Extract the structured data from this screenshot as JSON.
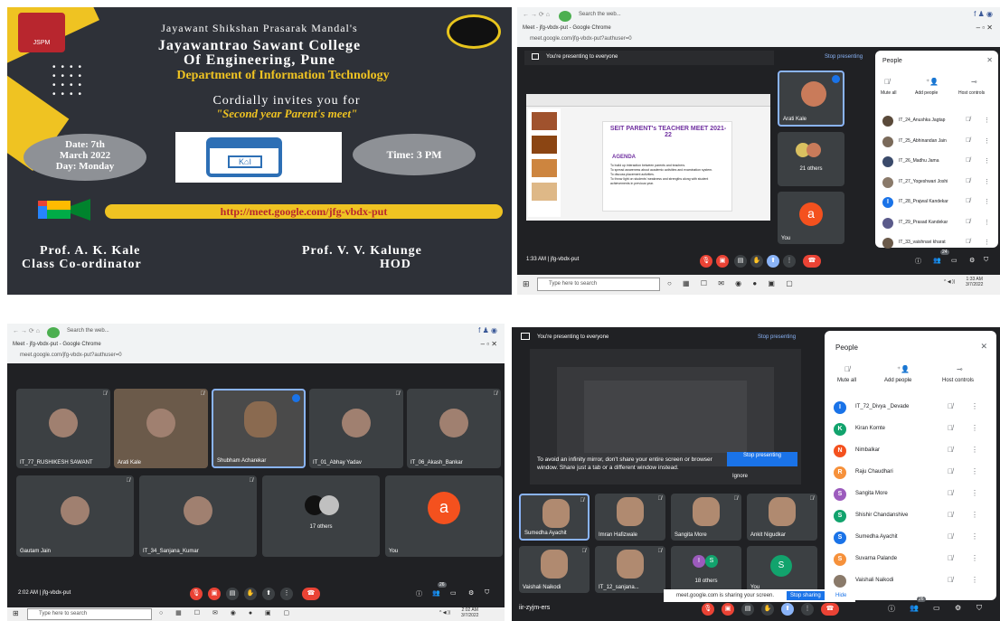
{
  "poster": {
    "org": "Jayawant Shikshan Prasarak Mandal's",
    "college_line1": "Jayawantrao Sawant College",
    "college_line2": "Of Engineering, Pune",
    "department": "Department of Information Technology",
    "invite": "Cordially invites you for",
    "event": "\"Second year Parent's meet\"",
    "date_line1": "Date: 7th",
    "date_line2": "March 2022",
    "date_line3": "Day: Monday",
    "time": "Time: 3 PM",
    "link": "http://meet.google.com/jfg-vbdx-put",
    "left_name": "Prof. A. K. Kale",
    "left_role": "Class Co-ordinator",
    "right_name": "Prof. V. V. Kalunge",
    "right_role": "HOD",
    "logo_left_text": "JSPM",
    "colors": {
      "bg": "#2e3138",
      "accent": "#efc322",
      "link": "#b8262e"
    }
  },
  "meet1": {
    "search_placeholder": "Search the web...",
    "window_title": "Meet - jfg-vbdx-put - Google Chrome",
    "url": "meet.google.com/jfg-vbdx-put?authuser=0",
    "presenting_banner": "You're presenting to everyone",
    "stop_presenting": "Stop presenting",
    "slide_title": "SEIT PARENT's TEACHER MEET 2021-22",
    "slide_agenda": "AGENDA",
    "slide_bullets": [
      "To build up interaction between parents and teachers.",
      "To spread awareness about academic activities and examination system.",
      "To discuss placement activities.",
      "To throw light on students' weakness and strengths along with student achievements in previous year."
    ],
    "tile_aarti": "Arati Kale",
    "tile_others": "21 others",
    "tile_you": "You",
    "you_initial": "a",
    "time": "1:33 AM",
    "meeting_code": "jfg-vbdx-put",
    "participant_count": "24",
    "people": {
      "title": "People",
      "mute_all": "Mute all",
      "add_people": "Add people",
      "host_controls": "Host controls",
      "rows": [
        {
          "name": "IT_24_Anushka Jagtap",
          "color": "#5a4a3a"
        },
        {
          "name": "IT_25_Abhinandan Jain",
          "color": "#7a6a5a"
        },
        {
          "name": "IT_26_Madhu Jama",
          "color": "#3a4a6a"
        },
        {
          "name": "IT_27_Yogeshwari Joshi",
          "color": "#8a7a6a"
        },
        {
          "name": "IT_28_Prajwal Kandekar",
          "color": "#1a73e8",
          "initial": "I"
        },
        {
          "name": "IT_29_Prasad Kandekar",
          "color": "#5a5a8a"
        },
        {
          "name": "IT_33_vaishnavi kharat",
          "color": "#6a5a4a"
        }
      ]
    },
    "taskbar_search": "Type here to search",
    "clock_time": "1:33 AM",
    "clock_date": "3/7/2022"
  },
  "meet2": {
    "search_placeholder": "Search the web...",
    "window_title": "Meet - jfg-vbdx-put - Google Chrome",
    "url": "meet.google.com/jfg-vbdx-put?authuser=0",
    "tiles": [
      {
        "name": "IT_77_RUSHIKESH SAWANT"
      },
      {
        "name": "Arati Kale"
      },
      {
        "name": "Shubham Acharekar"
      },
      {
        "name": "IT_01_Abhay Yadav"
      },
      {
        "name": "IT_06_Akash_Bankar"
      },
      {
        "name": "Gautam Jain"
      },
      {
        "name": "IT_34_Sanjana_Kumar"
      },
      {
        "name": "17 others"
      },
      {
        "name": "You"
      }
    ],
    "you_initial": "a",
    "time": "2:02 AM",
    "meeting_code": "jfg-vbdx-put",
    "participant_count": "26",
    "taskbar_search": "Type here to search",
    "clock_time": "2:02 AM",
    "clock_date": "3/7/2022"
  },
  "meet3": {
    "presenting_banner": "You're presenting to everyone",
    "stop_presenting": "Stop presenting",
    "mirror_warning": "To avoid an infinity mirror, don't share your entire screen or browser window. Share just a tab or a different window instead.",
    "stop_presenting_btn": "Stop presenting",
    "ignore_btn": "Ignore",
    "tiles": [
      {
        "name": "Sumedha Ayachit"
      },
      {
        "name": "Imran Hafizwale"
      },
      {
        "name": "Sangita More"
      },
      {
        "name": "Ankit Nigudkar"
      },
      {
        "name": "Vaishali Naikodi"
      },
      {
        "name": "IT_12_sanjana..."
      },
      {
        "name": "18 others"
      },
      {
        "name": "You"
      }
    ],
    "others_initials": [
      "I",
      "S"
    ],
    "you_initial": "S",
    "meeting_code": "iir-zyjm-ers",
    "participant_count": "26",
    "share_msg": "meet.google.com is sharing your screen.",
    "stop_sharing": "Stop sharing",
    "hide": "Hide",
    "people": {
      "title": "People",
      "mute_all": "Mute all",
      "add_people": "Add people",
      "host_controls": "Host controls",
      "rows": [
        {
          "name": "IT_72_Divya _Devade",
          "initial": "I",
          "color": "#1a73e8"
        },
        {
          "name": "Kiran Komte",
          "initial": "K",
          "color": "#12a36d"
        },
        {
          "name": "Nimbalkar",
          "initial": "N",
          "color": "#f4511e"
        },
        {
          "name": "Raju Chaudhari",
          "initial": "R",
          "color": "#f6913b"
        },
        {
          "name": "Sangita More",
          "initial": "S",
          "color": "#9c5bbd"
        },
        {
          "name": "Shishir Chandanshive",
          "initial": "S",
          "color": "#12a36d"
        },
        {
          "name": "Sumedha Ayachit",
          "initial": "S",
          "color": "#1a73e8"
        },
        {
          "name": "Suvarna Palande",
          "initial": "S",
          "color": "#f6913b"
        },
        {
          "name": "Vaishali Naikodi",
          "initial": "",
          "color": "#8a7a6a"
        }
      ]
    }
  }
}
